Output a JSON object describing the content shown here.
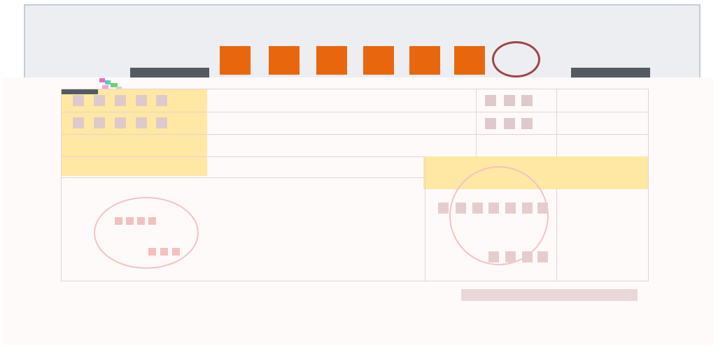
{
  "document": {
    "colors": {
      "banner_bg": "#eceef2",
      "banner_border": "#c2cdd8",
      "accent_orange": "#e8670e",
      "stamp_red": "#a04545",
      "highlight_yellow": "#ffe8a3",
      "redacted_block": "#decaca",
      "faint_stamp": "#f5c2c2"
    },
    "icons": [
      "logo-icon",
      "seal-stamp-icon",
      "faint-stamp-icon"
    ]
  }
}
